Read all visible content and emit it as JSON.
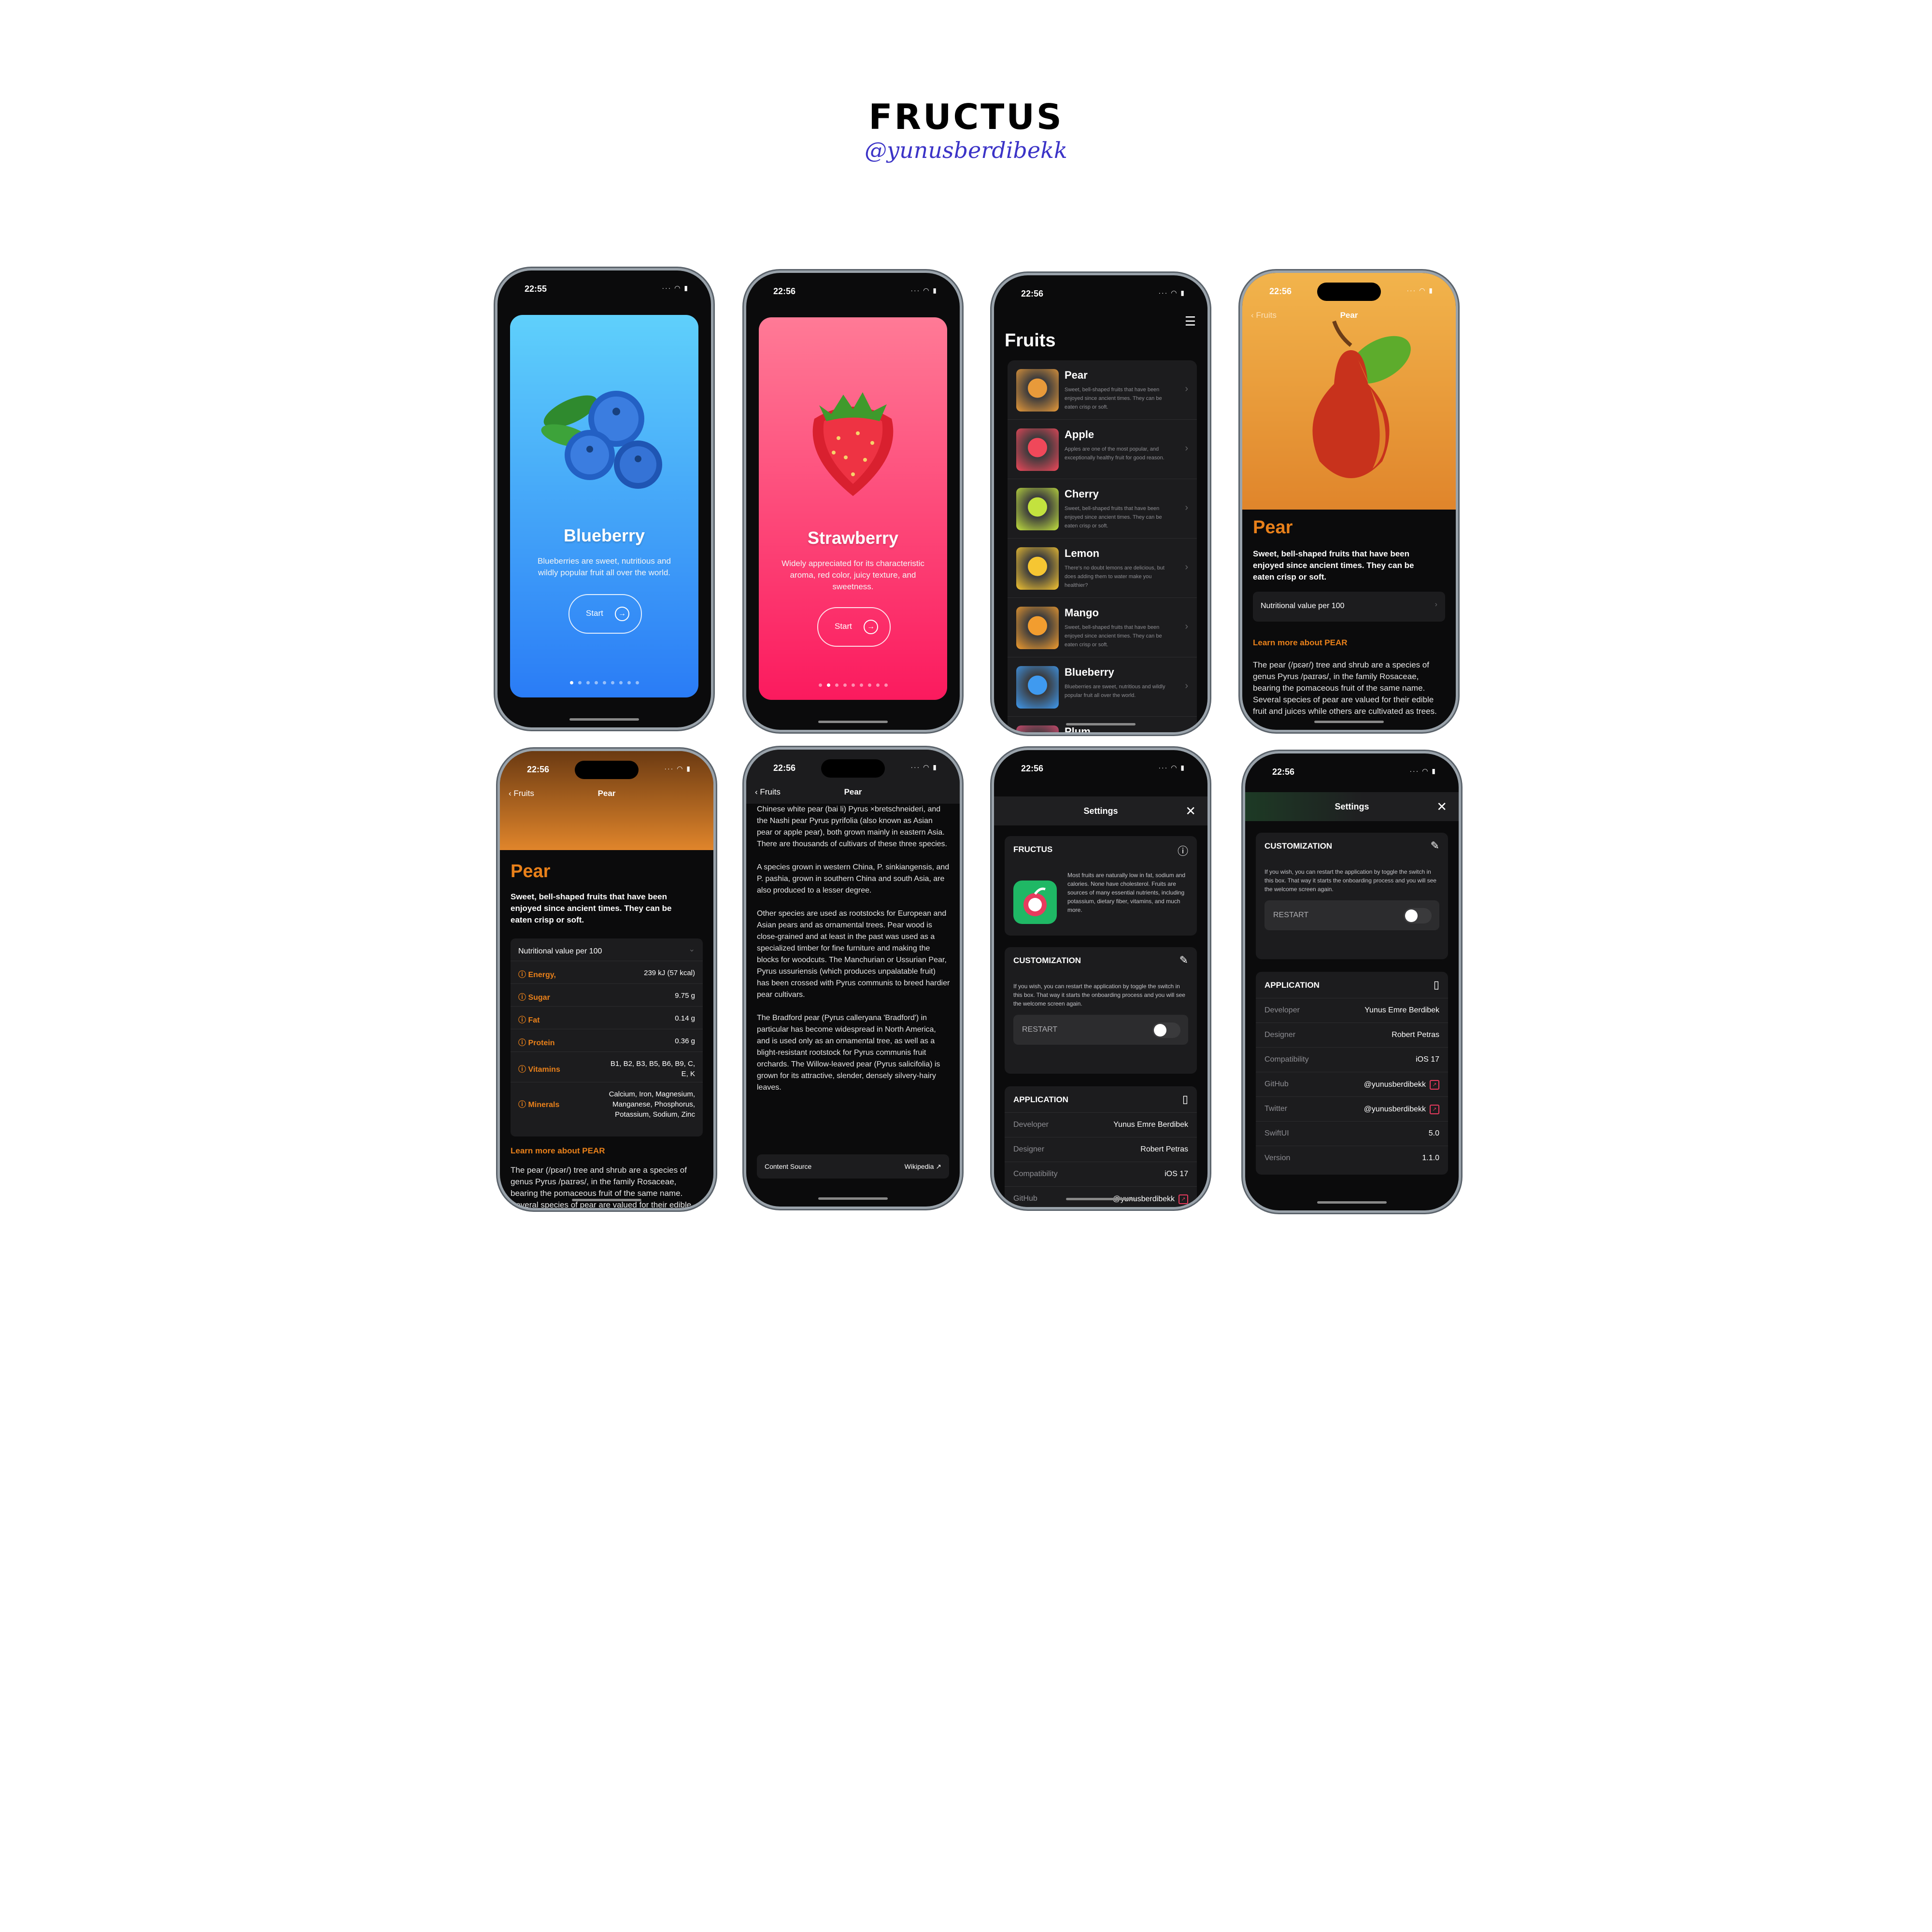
{
  "brand": {
    "title": "FRUCTUS",
    "handle": "@yunusberdibekk"
  },
  "status": {
    "time_1": "22:55",
    "time_2": "22:56",
    "indicators": "··· ◠ ▮"
  },
  "onboarding_blueberry": {
    "name": "Blueberry",
    "description": "Blueberries are sweet, nutritious and wildly popular fruit all over the world.",
    "start_label": "Start",
    "arrow": "→",
    "colors": {
      "top": "#5fd0fb",
      "bottom": "#2a7cf6"
    }
  },
  "onboarding_strawberry": {
    "name": "Strawberry",
    "description": "Widely appreciated for its characteristic aroma,  red color, juicy texture, and sweetness.",
    "start_label": "Start",
    "arrow": "→",
    "colors": {
      "top": "#ff7a96",
      "bottom": "#fb1a5e"
    }
  },
  "fruit_list": {
    "title": "Fruits",
    "filter_icon": "sliders-icon",
    "chevron": "›",
    "items": [
      {
        "name": "Pear",
        "description": "Sweet, bell-shaped fruits that have been enjoyed since ancient times. They can be eaten crisp or soft.",
        "color": "#e89a3a"
      },
      {
        "name": "Apple",
        "description": "Apples are one of the most popular, and exceptionally healthy fruit for good reason.",
        "color": "#f0485a"
      },
      {
        "name": "Cherry",
        "description": "Sweet, bell-shaped fruits that have been enjoyed since ancient times. They can be eaten crisp or soft.",
        "color": "#c3e23e"
      },
      {
        "name": "Lemon",
        "description": "There's no doubt lemons are delicious, but does adding them to water make you healthier?",
        "color": "#f6c632"
      },
      {
        "name": "Mango",
        "description": "Sweet, bell-shaped fruits that have been enjoyed since ancient times. They can be eaten crisp or soft.",
        "color": "#f29d2f"
      },
      {
        "name": "Blueberry",
        "description": "Blueberries are sweet, nutritious and wildly popular fruit all over the world.",
        "color": "#3f9af0"
      },
      {
        "name": "Plum",
        "description": "",
        "color": "#d94a72"
      }
    ]
  },
  "detail": {
    "back_label": "Fruits",
    "nav_title": "Pear",
    "title": "Pear",
    "headline": "Sweet, bell-shaped fruits that have been enjoyed since ancient times. They can be eaten crisp or soft.",
    "nutrition_label": "Nutritional value per 100",
    "chevron_right": "›",
    "chevron_down": "⌄",
    "nutrients": [
      {
        "name": "Energy,",
        "value": "239 kJ (57 kcal)"
      },
      {
        "name": "Sugar",
        "value": "9.75 g"
      },
      {
        "name": "Fat",
        "value": "0.14 g"
      },
      {
        "name": "Protein",
        "value": "0.36 g"
      },
      {
        "name": "Vitamins",
        "value": "B1, B2, B3, B5, B6, B9, C, E, K"
      },
      {
        "name": "Minerals",
        "value": "Calcium, Iron, Magnesium, Manganese, Phosphorus, Potassium, Sodium, Zinc"
      }
    ],
    "learn_more": "Learn more about PEAR",
    "body_intro": "The pear (/pɛər/) tree and shrub are a species of genus Pyrus /paɪrəs/, in the family Rosaceae, bearing the pomaceous fruit of the same name. Several species of pear are valued for their edible fruit and juices while others are cultivated as trees.",
    "body_p1": "Chinese white pear (bai li) Pyrus ×bretschneideri, and the Nashi pear Pyrus pyrifolia (also known as Asian pear or apple pear), both grown mainly in eastern Asia. There are thousands of cultivars of these three species.",
    "body_p2": "A species grown in western China, P. sinkiangensis, and P. pashia, grown in southern China and south Asia, are also produced to a lesser degree.",
    "body_p3": "Other species are used as rootstocks for European and Asian pears and as ornamental trees. Pear wood is close-grained and at least in the past was used as a specialized timber for fine furniture and making the blocks for woodcuts. The Manchurian or Ussurian Pear, Pyrus ussuriensis (which produces unpalatable fruit) has been crossed with Pyrus communis to breed hardier pear cultivars.",
    "body_p4": "The Bradford pear (Pyrus calleryana 'Bradford') in particular has become widespread in North America, and is used only as an ornamental tree, as well as a blight-resistant rootstock for Pyrus communis fruit orchards. The Willow-leaved pear (Pyrus salicifolia) is grown for its attractive, slender, densely silvery-hairy leaves.",
    "source_label": "Content Source",
    "source_value": "Wikipedia",
    "accent": "#e8801a"
  },
  "settings": {
    "title": "Settings",
    "close": "✕",
    "fructus_title": "FRUCTUS",
    "fructus_text": "Most fruits are naturally low in fat, sodium and calories. None have cholesterol. Fruits are sources of many essential nutrients, including potassium, dietary fiber, vitamins, and much more.",
    "customization_title": "CUSTOMIZATION",
    "customization_text": "If you wish, you can restart the application by toggle the switch in this box. That way it starts the onboarding process and you will see the welcome screen again.",
    "restart_label": "RESTART",
    "restart_on": false,
    "application_title": "APPLICATION",
    "rows": [
      {
        "key": "Developer",
        "value": "Yunus Emre Berdibek"
      },
      {
        "key": "Designer",
        "value": "Robert Petras"
      },
      {
        "key": "Compatibility",
        "value": "iOS 17"
      },
      {
        "key": "GitHub",
        "value": "@yunusberdibekk"
      },
      {
        "key": "Twitter",
        "value": "@yunusberdibekk"
      },
      {
        "key": "SwiftUI",
        "value": "5.0"
      },
      {
        "key": "Version",
        "value": "1.1.0"
      }
    ],
    "link_glyph": "↗"
  }
}
